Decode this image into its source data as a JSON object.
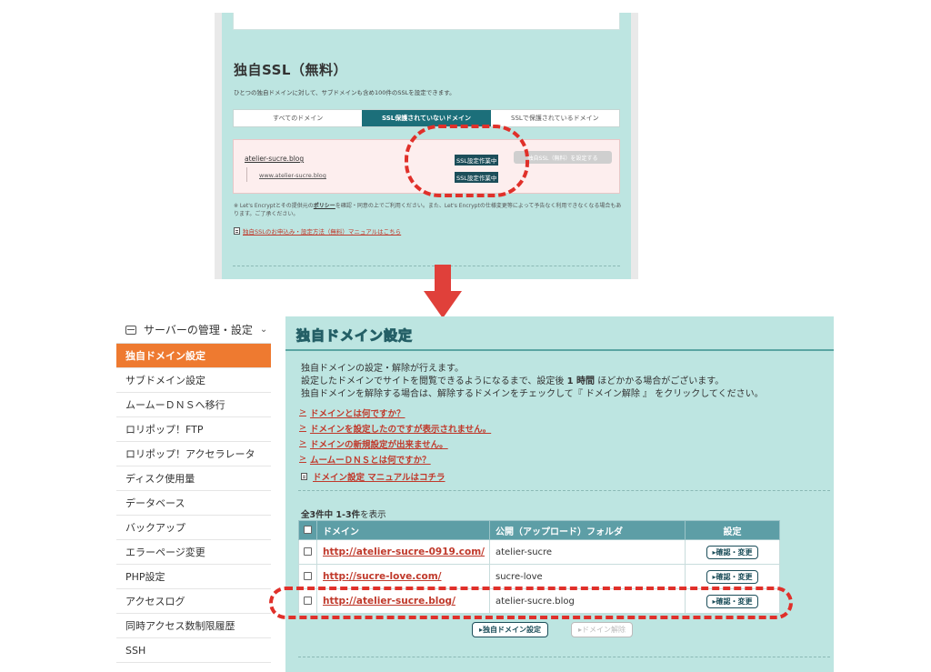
{
  "ssl": {
    "title": "独自SSL（無料）",
    "description": "ひとつの独自ドメインに対して、サブドメインも含め100件のSSLを設定できます。",
    "tabs": [
      "すべてのドメイン",
      "SSL保護されていないドメイン",
      "SSLで保護されているドメイン"
    ],
    "domain": "atelier-sucre.blog",
    "subdomain": "www.atelier-sucre.blog",
    "status": "SSL設定作業中",
    "set_button": "独自SSL（無料）を設定する",
    "note_pre": "※ Let's Encryptとその提供元の",
    "note_policy": "ポリシー",
    "note_post": "を確認・同意の上でご利用ください。また、Let's Encryptの仕様変更等によって予告なく利用できなくなる場合もあります。ご了承ください。",
    "manual_link": "独自SSLのお申込み・設定方法（無料）マニュアルはこちら"
  },
  "sidebar": {
    "header": "サーバーの管理・設定",
    "items": [
      "独自ドメイン設定",
      "サブドメイン設定",
      "ムームーＤＮＳへ移行",
      "ロリポップ！FTP",
      "ロリポップ！アクセラレータ",
      "ディスク使用量",
      "データベース",
      "バックアップ",
      "エラーページ変更",
      "PHP設定",
      "アクセスログ",
      "同時アクセス数制限履歴",
      "SSH"
    ]
  },
  "main": {
    "title": "独自ドメイン設定",
    "desc1": "独自ドメインの設定・解除が行えます。",
    "desc2_pre": "設定したドメインでサイトを閲覧できるようになるまで、設定後 ",
    "desc2_bold": "1 時間",
    "desc2_post": " ほどかかる場合がございます。",
    "desc3": "独自ドメインを解除する場合は、解除するドメインをチェックして『 ドメイン解除 』 をクリックしてください。",
    "help_links": [
      "ドメインとは何ですか？",
      "ドメインを設定したのですが表示されません。",
      "ドメインの新規設定が出来ません。",
      "ムームーＤＮＳとは何ですか？"
    ],
    "manual_link": "ドメイン設定 マニュアルはコチラ",
    "count_bold": "全3件中 1-3件",
    "count_suffix": "を表示",
    "table": {
      "headers": [
        "ドメイン",
        "公開（アップロード）フォルダ",
        "設定"
      ],
      "rows": [
        {
          "domain": "http://atelier-sucre-0919.com/",
          "folder": "atelier-sucre"
        },
        {
          "domain": "http://sucre-love.com/",
          "folder": "sucre-love"
        },
        {
          "domain": "http://atelier-sucre.blog/",
          "folder": "atelier-sucre.blog"
        }
      ],
      "button_label": "▸確認・変更"
    },
    "btn_set": "▸独自ドメイン設定",
    "btn_release": "▸ドメイン解除"
  }
}
